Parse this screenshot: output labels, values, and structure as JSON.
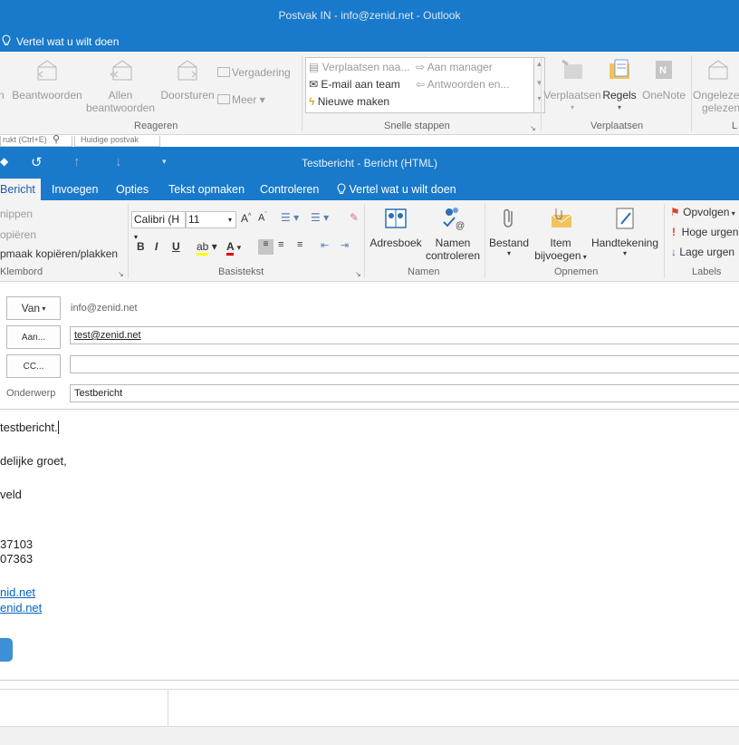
{
  "outlook": {
    "window_title": "Postvak IN - info@zenid.net - Outlook",
    "tell_me": "Vertel wat u wilt doen",
    "ribbon": {
      "reply_cut": "n",
      "reply": "Beantwoorden",
      "reply_all_line1": "Allen",
      "reply_all_line2": "beantwoorden",
      "forward": "Doorsturen",
      "meeting": "Vergadering",
      "more": "Meer",
      "group_respond": "Reageren",
      "quick_steps": [
        "Verplaatsen naa...",
        "Aan manager",
        "E-mail aan team",
        "Antwoorden en...",
        "Nieuwe maken"
      ],
      "group_quick_steps": "Snelle stappen",
      "move": "Verplaatsen",
      "rules": "Regels",
      "onenote": "OneNote",
      "group_move": "Verplaatsen",
      "unread_line1": "Ongeleze",
      "unread_line2": "gelezen",
      "group_tags_cut": "L"
    },
    "search_cut": "rukt (Ctrl+E)",
    "search_cut2": "Huidige postvak"
  },
  "compose": {
    "title": "Testbericht - Bericht (HTML)",
    "tabs": [
      "Bericht",
      "Invoegen",
      "Opties",
      "Tekst opmaken",
      "Controleren",
      "Vertel wat u wilt doen"
    ],
    "clipboard": {
      "cut": "nippen",
      "copy": "opiëren",
      "painter": "pmaak kopiëren/plakken",
      "label": "Klembord"
    },
    "basic_text": {
      "font": "Calibri (H",
      "size": "11",
      "label": "Basistekst"
    },
    "names": {
      "address_book": "Adresboek",
      "check_names_line1": "Namen",
      "check_names_line2": "controleren",
      "label": "Namen"
    },
    "include": {
      "file": "Bestand",
      "item_line1": "Item",
      "item_line2": "bijvoegen",
      "signature": "Handtekening",
      "label": "Opnemen"
    },
    "tags": {
      "follow_up": "Opvolgen",
      "high": "Hoge urgen",
      "low": "Lage urgen",
      "label": "Labels"
    },
    "fields": {
      "from_button": "Van",
      "from_value": "info@zenid.net",
      "to_button": "Aan...",
      "to_value": "test@zenid.net",
      "cc_button": "CC...",
      "cc_value": "",
      "subject_label": "Onderwerp",
      "subject_value": "Testbericht"
    },
    "body_lines": [
      {
        "text": "testbericht.",
        "link": false
      },
      {
        "text": "delijke groet,",
        "link": false
      },
      {
        "text": "veld",
        "link": false
      },
      {
        "text": "37103",
        "link": false
      },
      {
        "text": "07363",
        "link": false
      },
      {
        "text": "nid.net",
        "link": true
      },
      {
        "text": "enid.net",
        "link": true
      }
    ],
    "colors": {
      "accent": "#1979ca",
      "ribbon_bg": "#f3f3f3",
      "link": "#0563c1"
    }
  }
}
